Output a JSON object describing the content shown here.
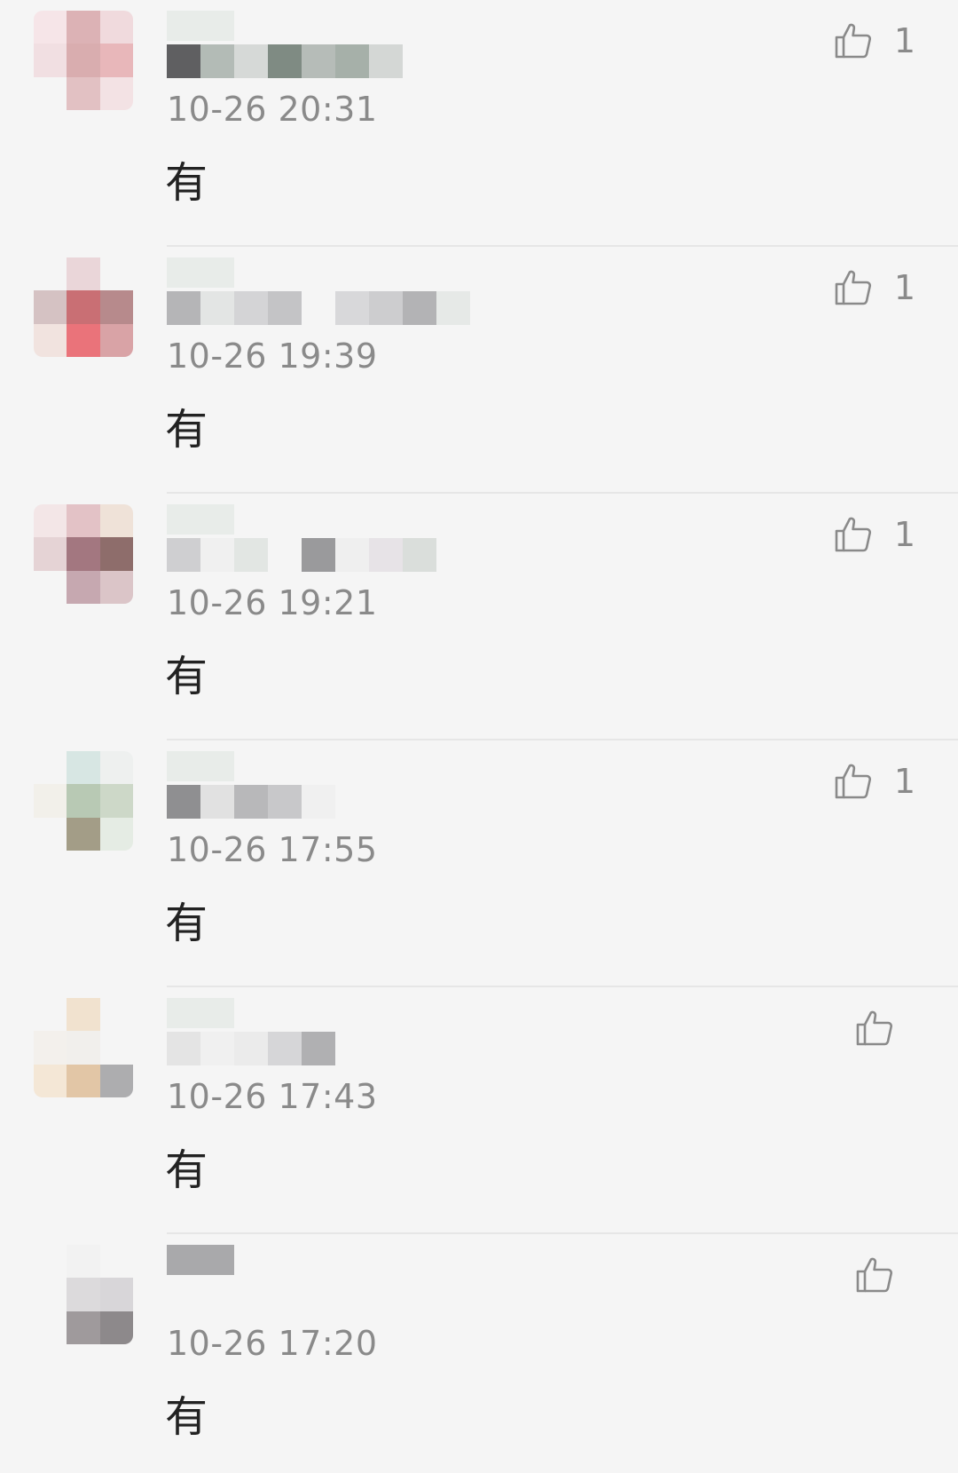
{
  "comments": [
    {
      "time": "10-26 20:31",
      "text": "有",
      "likes": "1"
    },
    {
      "time": "10-26 19:39",
      "text": "有",
      "likes": "1"
    },
    {
      "time": "10-26 19:21",
      "text": "有",
      "likes": "1"
    },
    {
      "time": "10-26 17:55",
      "text": "有",
      "likes": "1"
    },
    {
      "time": "10-26 17:43",
      "text": "有",
      "likes": ""
    },
    {
      "time": "10-26 17:20",
      "text": "有",
      "likes": ""
    }
  ],
  "icons": {
    "avatar": "blurred-avatar",
    "like": "thumbs-up-icon"
  },
  "colors": {
    "background": "#f5f5f5",
    "meta_text": "#8a8a8a",
    "body_text": "#222222",
    "divider": "#e6e6e6"
  }
}
